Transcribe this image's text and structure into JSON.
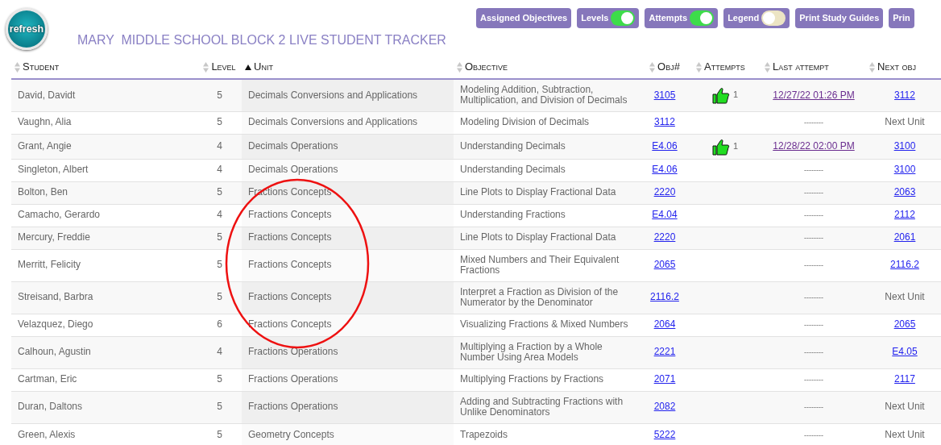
{
  "logo": {
    "text": "refresh"
  },
  "title": "MARY  MIDDLE SCHOOL BLOCK 2 LIVE STUDENT TRACKER",
  "toolbar": [
    {
      "label": "Assigned Objectives",
      "kind": "button"
    },
    {
      "label": "Levels",
      "kind": "toggle",
      "on": true
    },
    {
      "label": "Attempts",
      "kind": "toggle",
      "on": true
    },
    {
      "label": "Legend",
      "kind": "toggle",
      "on": false
    },
    {
      "label": "Print Study Guides",
      "kind": "button"
    },
    {
      "label": "Prin",
      "kind": "button"
    }
  ],
  "table": {
    "columns": [
      {
        "label": "Student",
        "sorted": false
      },
      {
        "label": "Level",
        "sorted": false
      },
      {
        "label": "Unit",
        "sorted": true
      },
      {
        "label": "Objective",
        "sorted": false
      },
      {
        "label": "Obj#",
        "sorted": false
      },
      {
        "label": "Attempts",
        "sorted": false
      },
      {
        "label": "Last attempt",
        "sorted": false
      },
      {
        "label": "Next obj",
        "sorted": false
      }
    ],
    "rows": [
      {
        "student": "David, Davidt",
        "level": "5",
        "unit": "Decimals Conversions and Applications",
        "objective": "Modeling Addition, Subtraction, Multiplication, and Division of Decimals",
        "obj": "3105",
        "attempts": "1",
        "last_attempt": "12/27/22 01:26 PM",
        "last_attempt_link": true,
        "next_obj": "3112",
        "next_obj_link": true
      },
      {
        "student": "Vaughn, Alia",
        "level": "5",
        "unit": "Decimals Conversions and Applications",
        "objective": "Modeling Division of Decimals",
        "obj": "3112",
        "last_attempt": "--------",
        "last_attempt_link": false,
        "next_obj": "Next Unit",
        "next_obj_link": false
      },
      {
        "student": "Grant, Angie",
        "level": "4",
        "unit": "Decimals Operations",
        "objective": "Understanding Decimals",
        "obj": "E4.06",
        "attempts": "1",
        "last_attempt": "12/28/22 02:00 PM",
        "last_attempt_link": true,
        "next_obj": "3100",
        "next_obj_link": true
      },
      {
        "student": "Singleton, Albert",
        "level": "4",
        "unit": "Decimals Operations",
        "objective": "Understanding Decimals",
        "obj": "E4.06",
        "last_attempt": "--------",
        "last_attempt_link": false,
        "next_obj": "3100",
        "next_obj_link": true
      },
      {
        "student": "Bolton, Ben",
        "level": "5",
        "unit": "Fractions Concepts",
        "objective": "Line Plots to Display Fractional Data",
        "obj": "2220",
        "last_attempt": "--------",
        "last_attempt_link": false,
        "next_obj": "2063",
        "next_obj_link": true
      },
      {
        "student": "Camacho, Gerardo",
        "level": "4",
        "unit": "Fractions Concepts",
        "objective": "Understanding Fractions",
        "obj": "E4.04",
        "last_attempt": "--------",
        "last_attempt_link": false,
        "next_obj": "2112",
        "next_obj_link": true
      },
      {
        "student": "Mercury, Freddie",
        "level": "5",
        "unit": "Fractions Concepts",
        "objective": "Line Plots to Display Fractional Data",
        "obj": "2220",
        "last_attempt": "--------",
        "last_attempt_link": false,
        "next_obj": "2061",
        "next_obj_link": true
      },
      {
        "student": "Merritt, Felicity",
        "level": "5",
        "unit": "Fractions Concepts",
        "objective": "Mixed Numbers and Their Equivalent Fractions",
        "obj": "2065",
        "last_attempt": "--------",
        "last_attempt_link": false,
        "next_obj": "2116.2",
        "next_obj_link": true
      },
      {
        "student": "Streisand, Barbra",
        "level": "5",
        "unit": "Fractions Concepts",
        "objective": "Interpret a Fraction as Division of the Numerator by the Denominator",
        "obj": "2116.2",
        "last_attempt": "--------",
        "last_attempt_link": false,
        "next_obj": "Next Unit",
        "next_obj_link": false
      },
      {
        "student": "Velazquez, Diego",
        "level": "6",
        "unit": "Fractions Concepts",
        "objective": "Visualizing Fractions & Mixed Numbers",
        "obj": "2064",
        "last_attempt": "--------",
        "last_attempt_link": false,
        "next_obj": "2065",
        "next_obj_link": true
      },
      {
        "student": "Calhoun, Agustin",
        "level": "4",
        "unit": "Fractions Operations",
        "objective": "Multiplying a Fraction by a Whole Number Using Area Models",
        "obj": "2221",
        "last_attempt": "--------",
        "last_attempt_link": false,
        "next_obj": "E4.05",
        "next_obj_link": true
      },
      {
        "student": "Cartman, Eric",
        "level": "5",
        "unit": "Fractions Operations",
        "objective": "Multiplying Fractions by Fractions",
        "obj": "2071",
        "last_attempt": "--------",
        "last_attempt_link": false,
        "next_obj": "2117",
        "next_obj_link": true
      },
      {
        "student": "Duran, Daltons",
        "level": "5",
        "unit": "Fractions Operations",
        "objective": "Adding and Subtracting Fractions with Unlike Denominators",
        "obj": "2082",
        "last_attempt": "--------",
        "last_attempt_link": false,
        "next_obj": "Next Unit",
        "next_obj_link": false
      },
      {
        "student": "Green, Alexis",
        "level": "5",
        "unit": "Geometry Concepts",
        "objective": "Trapezoids",
        "obj": "5222",
        "last_attempt": "--------",
        "last_attempt_link": false,
        "next_obj": "Next Unit",
        "next_obj_link": false
      }
    ]
  },
  "annotation": {
    "kind": "ellipse"
  }
}
